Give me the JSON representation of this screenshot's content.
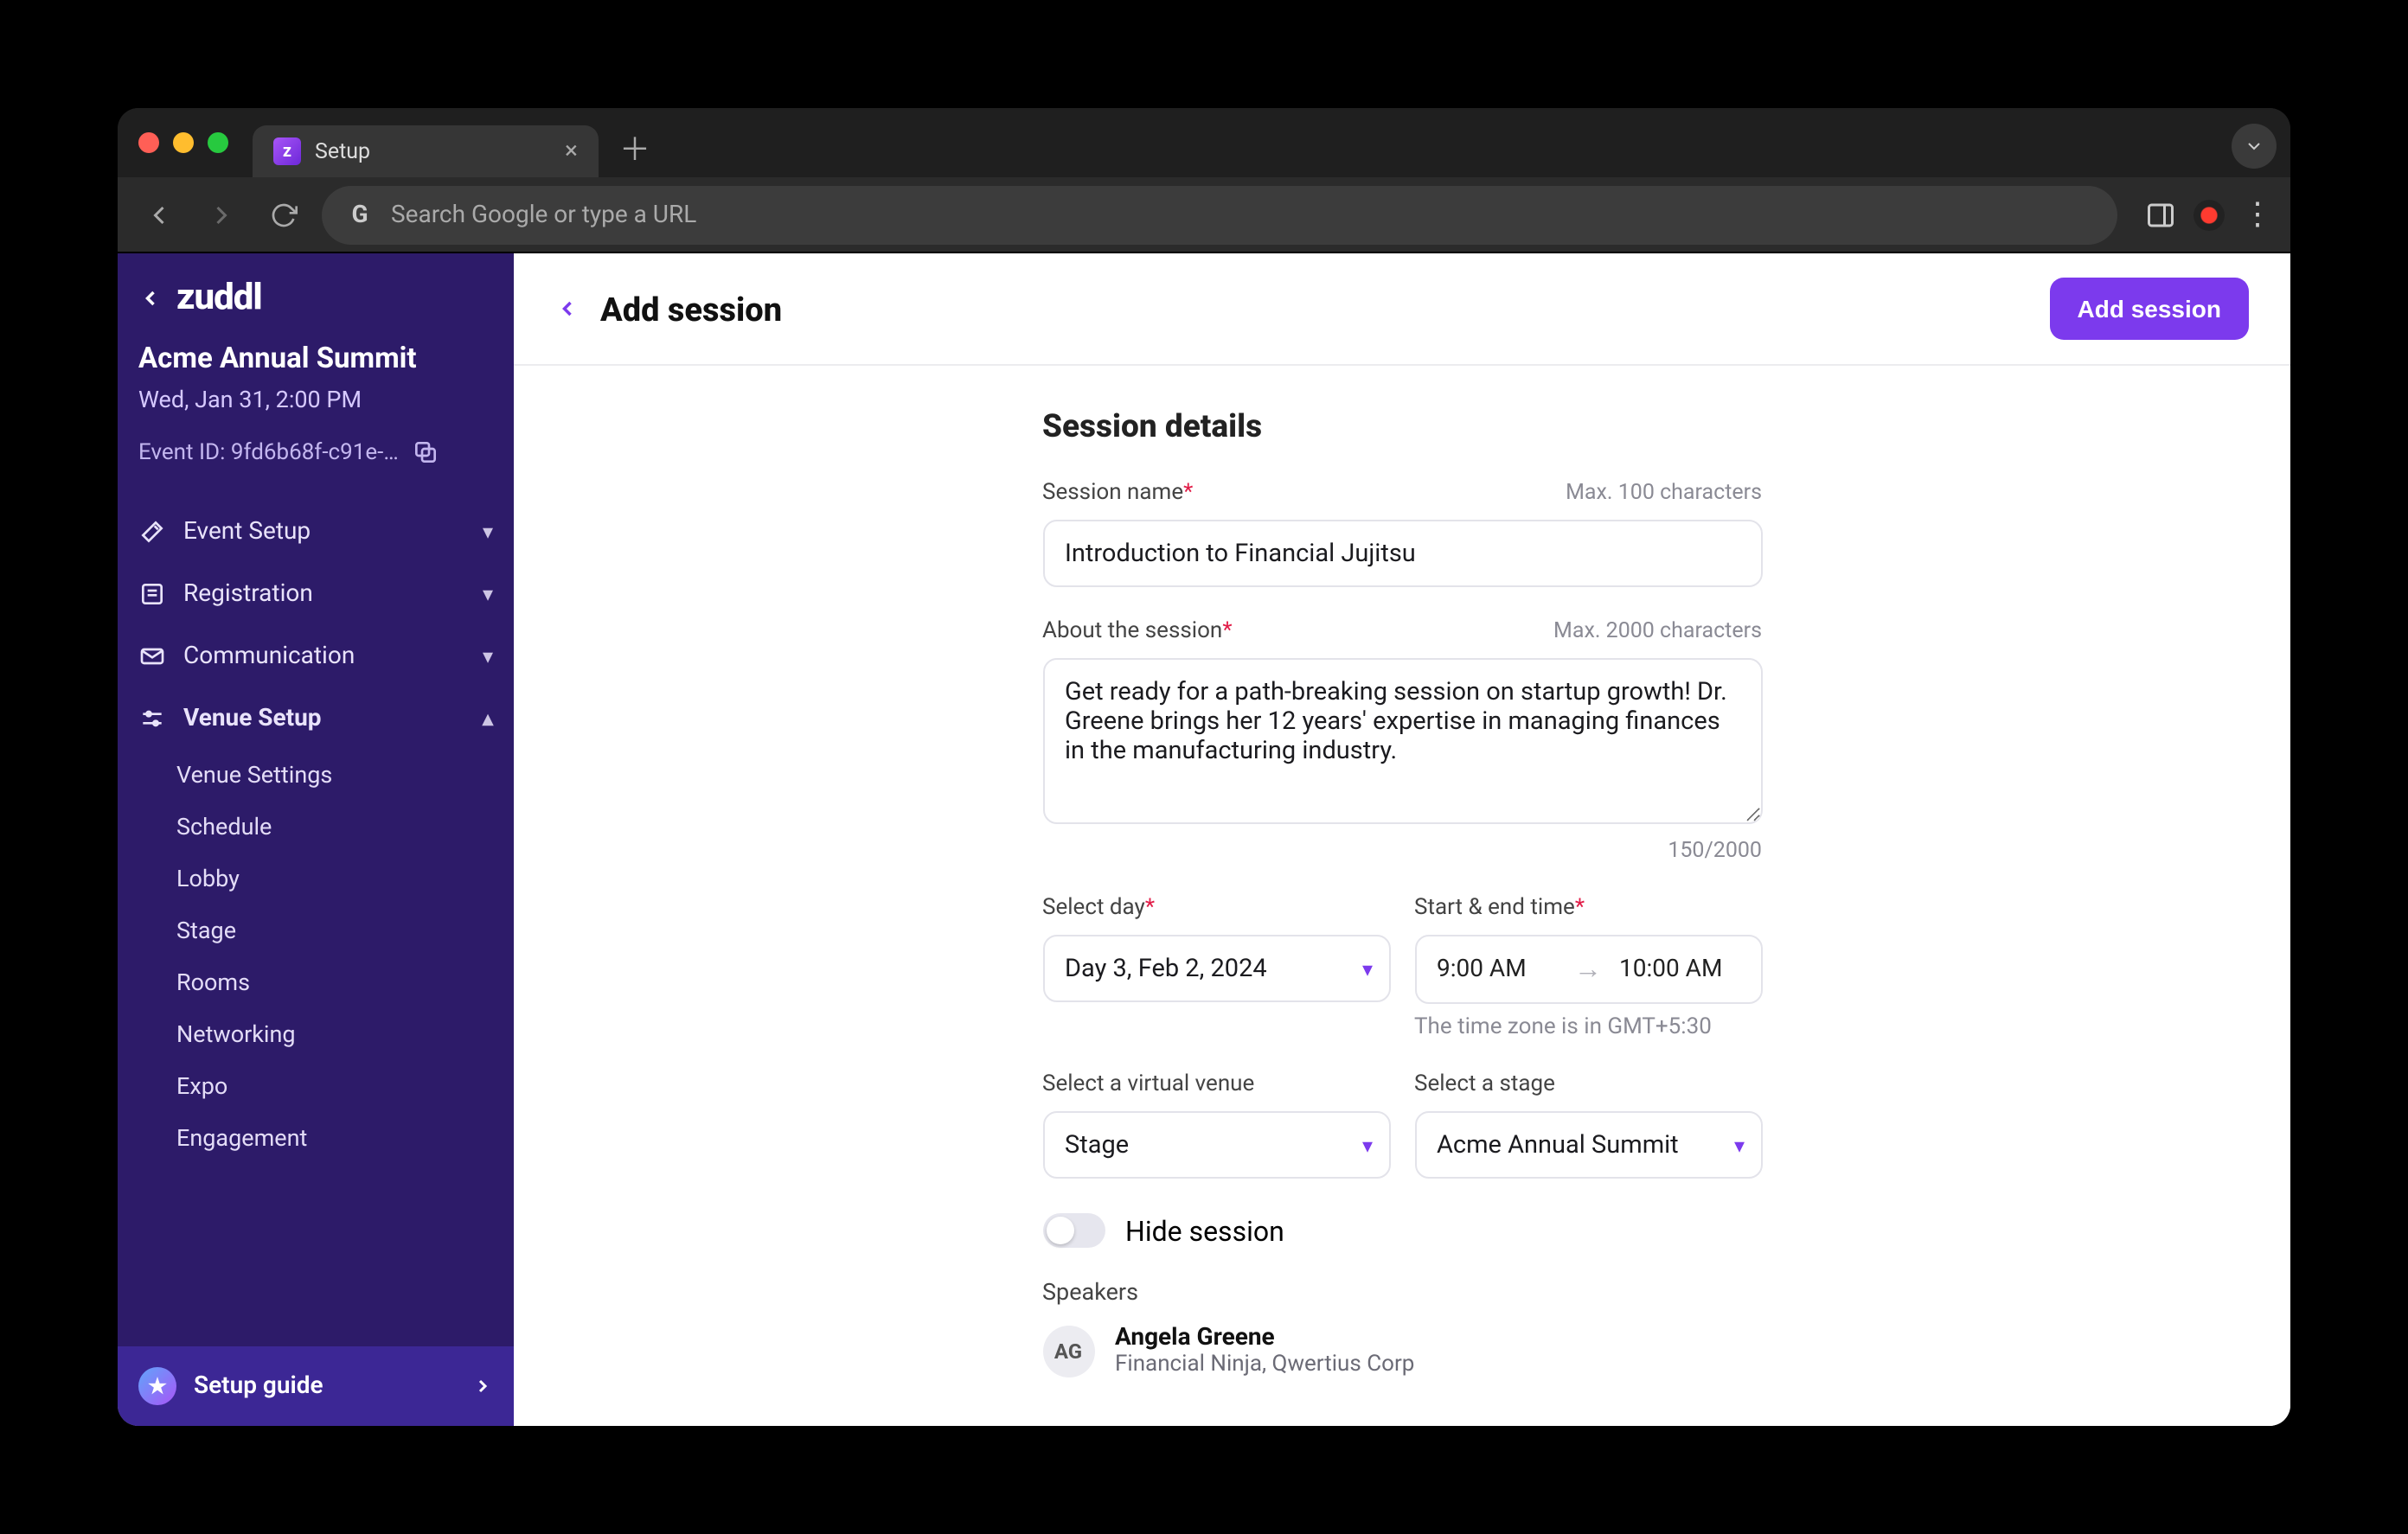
{
  "browser": {
    "tab_title": "Setup",
    "omnibox_placeholder": "Search Google or type a URL"
  },
  "sidebar": {
    "brand": "zuddl",
    "event_name": "Acme Annual Summit",
    "event_date": "Wed, Jan 31, 2:00 PM",
    "event_id_label": "Event ID: 9fd6b68f-c91e-…",
    "items": [
      {
        "label": "Event Setup"
      },
      {
        "label": "Registration"
      },
      {
        "label": "Communication"
      },
      {
        "label": "Venue Setup"
      }
    ],
    "venue_sub": [
      {
        "label": "Venue Settings"
      },
      {
        "label": "Schedule"
      },
      {
        "label": "Lobby"
      },
      {
        "label": "Stage"
      },
      {
        "label": "Rooms"
      },
      {
        "label": "Networking"
      },
      {
        "label": "Expo"
      },
      {
        "label": "Engagement"
      }
    ],
    "setup_guide": "Setup guide"
  },
  "main": {
    "header_title": "Add session",
    "primary_button": "Add session",
    "section_title": "Session details",
    "session_name_label": "Session name",
    "session_name_hint": "Max. 100 characters",
    "session_name_value": "Introduction to Financial Jujitsu",
    "about_label": "About the session",
    "about_hint": "Max. 2000 characters",
    "about_value": "Get ready for a path-breaking session on startup growth! Dr. Greene brings her 12 years' expertise in managing finances in the manufacturing industry.",
    "about_counter": "150/2000",
    "select_day_label": "Select day",
    "select_day_value": "Day 3, Feb 2, 2024",
    "time_label": "Start & end time",
    "time_start": "9:00 AM",
    "time_end": "10:00 AM",
    "timezone_note": "The time zone is in GMT+5:30",
    "virtual_venue_label": "Select a virtual venue",
    "virtual_venue_value": "Stage",
    "stage_label": "Select a stage",
    "stage_value": "Acme Annual Summit",
    "hide_session_label": "Hide session",
    "speakers_label": "Speakers",
    "speaker": {
      "initials": "AG",
      "name": "Angela Greene",
      "subtitle": "Financial Ninja, Qwertius Corp"
    }
  }
}
